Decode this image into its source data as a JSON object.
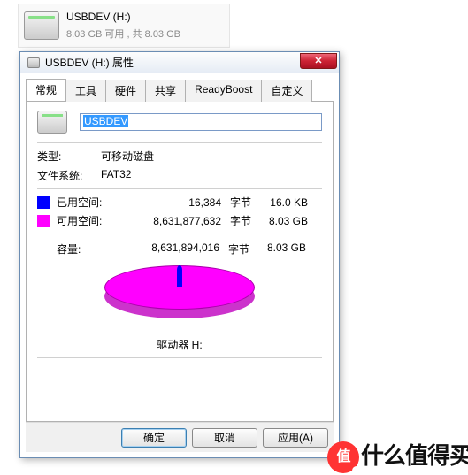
{
  "tile": {
    "name": "USBDEV (H:)",
    "sub": "8.03 GB 可用 , 共 8.03 GB"
  },
  "dialog": {
    "title": "USBDEV (H:) 属性",
    "tabs": [
      "常规",
      "工具",
      "硬件",
      "共享",
      "ReadyBoost",
      "自定义"
    ],
    "volume_name": "USBDEV",
    "type_label": "类型:",
    "type_value": "可移动磁盘",
    "fs_label": "文件系统:",
    "fs_value": "FAT32",
    "used_label": "已用空间:",
    "used_bytes": "16,384",
    "used_size": "16.0 KB",
    "free_label": "可用空间:",
    "free_bytes": "8,631,877,632",
    "free_size": "8.03 GB",
    "bytes_unit": "字节",
    "capacity_label": "容量:",
    "capacity_bytes": "8,631,894,016",
    "capacity_size": "8.03 GB",
    "drive_label": "驱动器 H:",
    "ok": "确定",
    "cancel": "取消",
    "apply": "应用(A)"
  },
  "watermark": {
    "dot": "值",
    "text": "什么值得买"
  }
}
